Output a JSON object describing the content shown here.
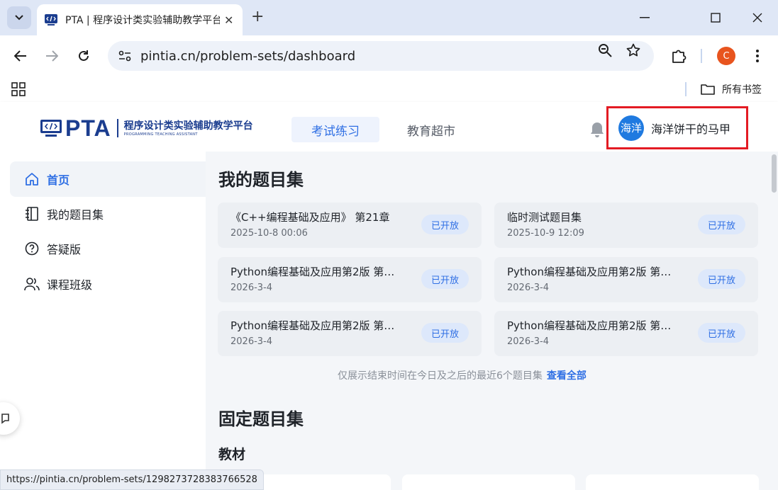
{
  "browser": {
    "tab_title": "PTA | 程序设计类实验辅助教学平台",
    "url": "pintia.cn/problem-sets/dashboard",
    "profile_initial": "C",
    "bookmarks_all": "所有书签",
    "status_url": "https://pintia.cn/problem-sets/1298273728383766528"
  },
  "header": {
    "logo_text": "PTA",
    "logo_cn": "程序设计类实验辅助教学平台",
    "logo_en": "PROGRAMMING TEACHING ASSISTANT",
    "nav": [
      "考试练习",
      "教育超市"
    ],
    "avatar_text": "海洋",
    "user_name": "海洋饼干的马甲"
  },
  "sidebar": {
    "items": [
      {
        "label": "首页",
        "icon": "home-icon",
        "active": true
      },
      {
        "label": "我的题目集",
        "icon": "notebook-icon",
        "active": false
      },
      {
        "label": "答疑版",
        "icon": "question-icon",
        "active": false
      },
      {
        "label": "课程班级",
        "icon": "users-icon",
        "active": false
      }
    ]
  },
  "main": {
    "my_sets_title": "我的题目集",
    "cards": [
      {
        "name": "《C++编程基础及应用》 第21章",
        "date": "2025-10-8 00:06",
        "status": "已开放"
      },
      {
        "name": "临时测试题目集",
        "date": "2025-10-9 12:09",
        "status": "已开放"
      },
      {
        "name": "Python编程基础及应用第2版 第…",
        "date": "2026-3-4",
        "status": "已开放"
      },
      {
        "name": "Python编程基础及应用第2版 第…",
        "date": "2026-3-4",
        "status": "已开放"
      },
      {
        "name": "Python编程基础及应用第2版 第…",
        "date": "2026-3-4",
        "status": "已开放"
      },
      {
        "name": "Python编程基础及应用第2版 第…",
        "date": "2026-3-4",
        "status": "已开放"
      }
    ],
    "hint": "仅展示结束时间在今日及之后的最近6个题目集",
    "view_all": "查看全部",
    "pinned_title": "固定题目集",
    "textbook_title": "教材"
  },
  "colors": {
    "accent": "#2f6fe4",
    "brand": "#1b3d8f",
    "highlight_box": "#e31b23"
  }
}
